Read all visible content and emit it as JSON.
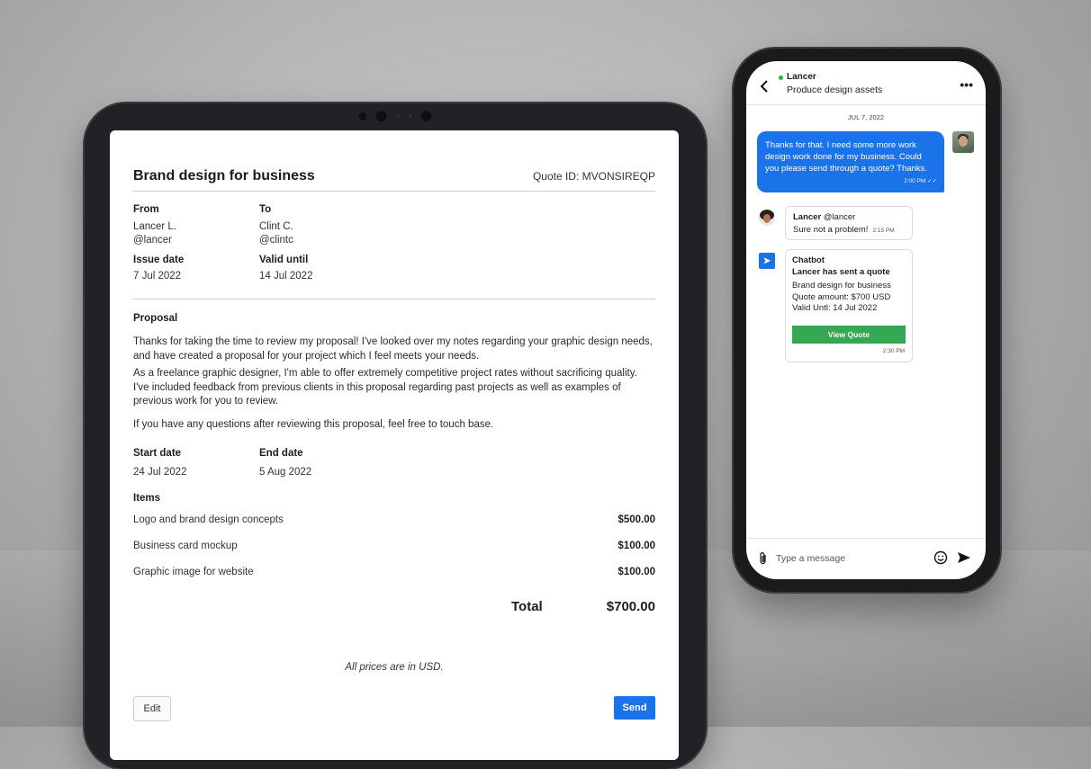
{
  "quote": {
    "title": "Brand design for business",
    "quote_id": "Quote ID: MVONSIREQP",
    "from_label": "From",
    "from_name": "Lancer L.",
    "from_handle": "@lancer",
    "to_label": "To",
    "to_name": "Clint C.",
    "to_handle": "@clintc",
    "issue_label": "Issue date",
    "issue_date": "7 Jul 2022",
    "valid_label": "Valid until",
    "valid_date": "14 Jul 2022",
    "proposal_label": "Proposal",
    "paragraphs": [
      "Thanks for taking the time to review my proposal! I've looked over my notes regarding your graphic design needs, and have created a proposal for your project which I feel meets your needs.",
      "As a freelance graphic designer, I'm able to offer extremely competitive project rates without sacrificing quality. I've included feedback from previous clients in this proposal regarding past projects as well as examples of previous work for you to review.",
      "If you have any questions after reviewing this proposal, feel free to touch base."
    ],
    "start_label": "Start date",
    "start_date": "24 Jul 2022",
    "end_label": "End date",
    "end_date": "5 Aug 2022",
    "items_label": "Items",
    "items": [
      {
        "name": "Logo and brand design concepts",
        "price": "$500.00"
      },
      {
        "name": "Business card mockup",
        "price": "$100.00"
      },
      {
        "name": "Graphic image for website",
        "price": "$100.00"
      }
    ],
    "total_label": "Total",
    "total_value": "$700.00",
    "note": "All prices are in USD.",
    "edit_button": "Edit",
    "send_button": "Send"
  },
  "chat": {
    "contact_name": "Lancer",
    "subtitle": "Produce design assets",
    "more_icon": "more-horizontal-icon",
    "date": "JUL 7, 2022",
    "outgoing": {
      "text": "Thanks for that. I need some more work design work done for my business. Could you please send through a quote? Thanks.",
      "time": "2:00 PM"
    },
    "lancer_msg": {
      "sender": "Lancer",
      "handle": "@lancer",
      "text": "Sure not a problem!",
      "time": "2:15 PM"
    },
    "bot_msg": {
      "sender": "Chatbot",
      "headline": "Lancer has sent a quote",
      "line1": "Brand design for business",
      "line2": "Quote amount: $700 USD",
      "line3": "Valid Untl: 14 Jul 2022",
      "button": "View Quote",
      "time": "2:30 PM"
    },
    "input_placeholder": "Type a message"
  },
  "colors": {
    "accent_blue": "#1a73e8",
    "view_quote_green": "#34a853",
    "online_green": "#2fb14a"
  }
}
